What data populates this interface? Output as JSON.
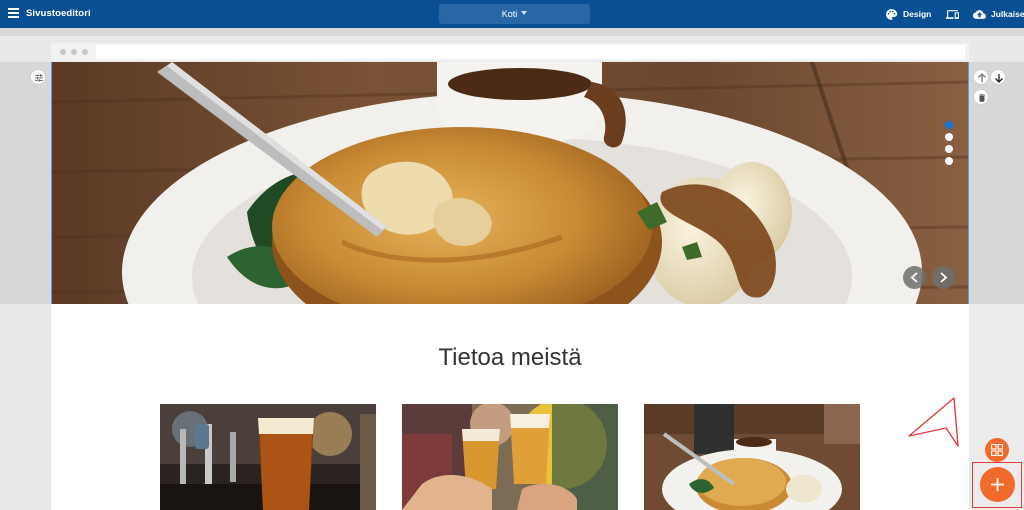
{
  "topbar": {
    "app_title": "Sivustoeditori",
    "page_select": "Koti",
    "design_label": "Design",
    "publish_label": "Julkaise"
  },
  "hero": {
    "slide_count": 4,
    "active_slide": 1
  },
  "content": {
    "section_title": "Tietoa meistä"
  },
  "colors": {
    "topbar": "#0a4f93",
    "accent": "#f26a2b",
    "selection": "#5d9de0",
    "highlight": "#e23c3c"
  },
  "icons": [
    "menu-icon",
    "palette-icon",
    "devices-icon",
    "cloud-upload-icon",
    "sliders-icon",
    "arrow-up-icon",
    "arrow-down-icon",
    "trash-icon",
    "chevron-left-icon",
    "chevron-right-icon",
    "widgets-icon",
    "plus-icon"
  ]
}
